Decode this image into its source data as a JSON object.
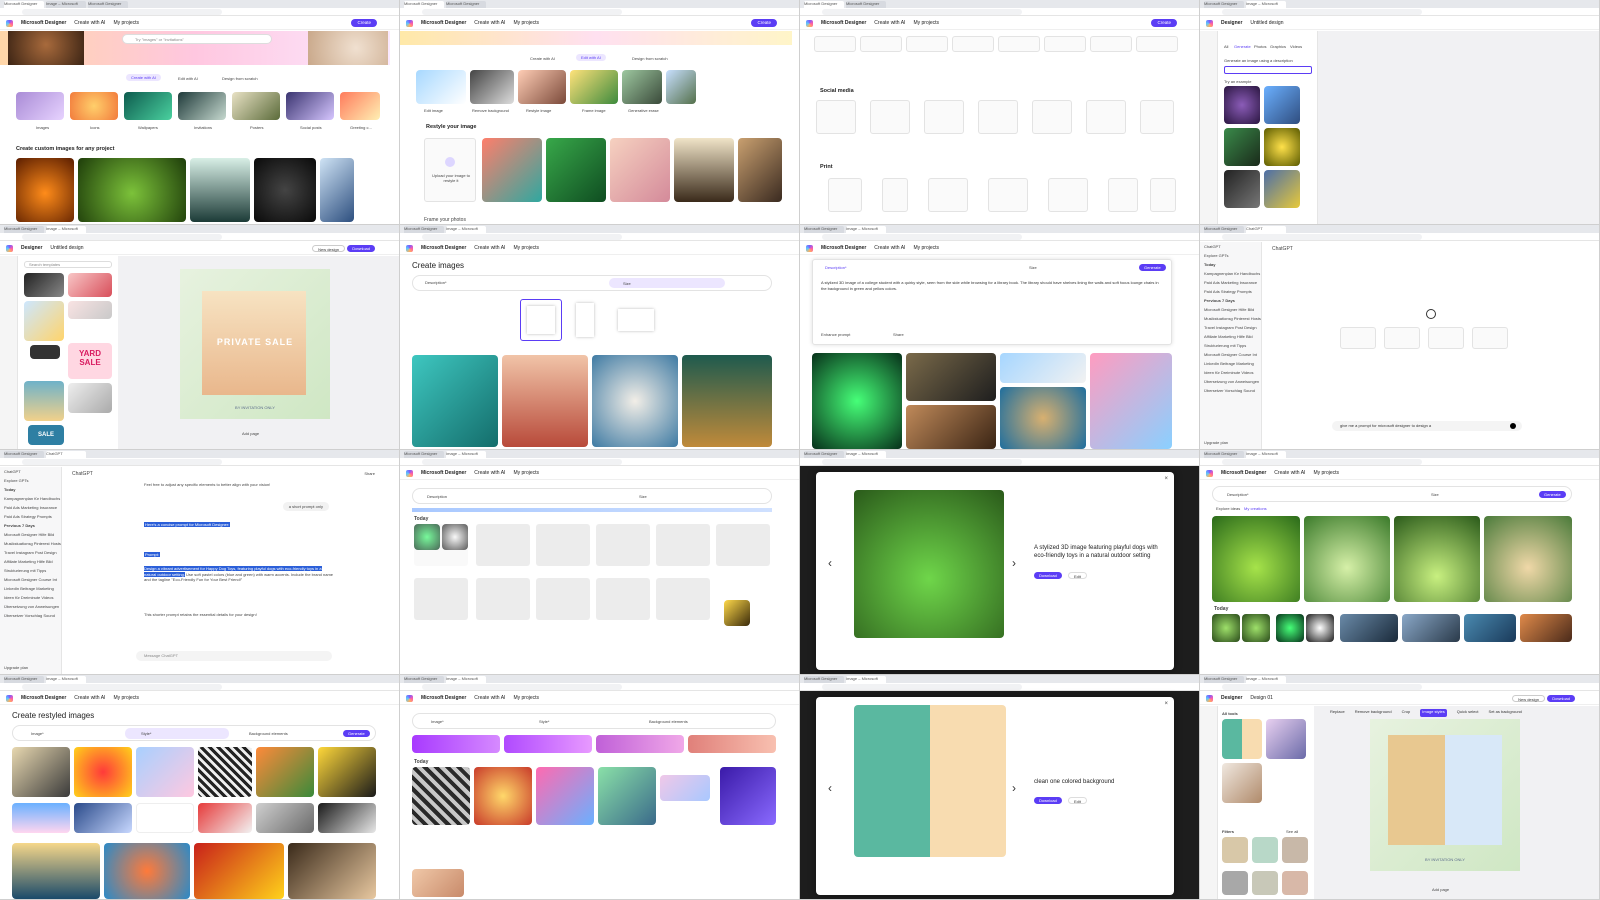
{
  "brand": "Microsoft Designer",
  "nav": {
    "create_with_ai": "Create with AI",
    "my_projects": "My projects",
    "create": "Create",
    "untitled": "Untitled design"
  },
  "tabs": [
    "Microsoft Designer",
    "Image – Microsoft",
    "Microsoft Designer",
    "ChatGPT"
  ],
  "p1": {
    "search_placeholder": "Try \"images\" or \"invitations\"",
    "options": [
      "Create with AI",
      "Edit with AI",
      "Design from scratch"
    ],
    "cats": [
      "Images",
      "Icons",
      "Wallpapers",
      "Invitations",
      "Posters",
      "Social posts",
      "Greeting c..."
    ],
    "section": "Create custom images for any project"
  },
  "p2": {
    "options": [
      "Create with AI",
      "Edit with AI",
      "Design from scratch"
    ],
    "tools": [
      "Edit image",
      "Remove background",
      "Restyle image",
      "Frame image",
      "Generative erase"
    ],
    "section": "Restyle your image",
    "upload": "Upload your image to restyle it",
    "next": "Frame your photos"
  },
  "p3": {
    "social": "Social media",
    "print": "Print"
  },
  "p4": {
    "designer": "Designer",
    "tabs": [
      "All",
      "Generate",
      "Photos",
      "Graphics",
      "Videos"
    ],
    "prompt_label": "Generate an image using a description",
    "try": "Try an example"
  },
  "p5": {
    "new_design": "New design",
    "download": "Download",
    "search": "Search templates",
    "yard": "YARD SALE",
    "sale": "SALE",
    "private": "PRIVATE SALE",
    "sub": "BY INVITATION ONLY",
    "addpage": "Add page"
  },
  "p6": {
    "title": "Create images",
    "desc": "Description*",
    "size": "Size"
  },
  "p7": {
    "desc": "Description*",
    "size": "Size",
    "prompt": "A stylized 3D image of a college student with a quirky style, seen from the side while browsing for a library book. The library should have shelves lining the walls and soft focus lounge chairs in the background in green and yellow colors.",
    "generate": "Generate",
    "enhance": "Enhance prompt",
    "share": "Share"
  },
  "p8": {
    "chatgpt": "ChatGPT",
    "input": "give me a prompt for microsoft designer to design a",
    "upgrade": "Upgrade plan",
    "items": [
      "ChatGPT",
      "Explore GPTs",
      "Today",
      "Kampagnenplan für Handbuchs",
      "Paid Ads Marketing Insurance",
      "Paid Ads Strategy Prompts",
      "Previous 7 Days",
      "Microsoft Designer Hilfe Bild",
      "Musikstuationsg Pinterest Hosts",
      "Travel Instagram Post Design",
      "Affiliate Marketing Hilfe Bild",
      "Strukturierung mit Tipps",
      "Microsoft Designer Course Int",
      "LinkedIn Beitrage Marketing",
      "Ideen für Dreiminute Videos",
      "Übersetzung von Anweisungen",
      "Übersetzer Vorschlag Sound"
    ]
  },
  "p9": {
    "chatgpt": "ChatGPT",
    "msg1": "Feel free to adjust any specific elements to better align with your vision!",
    "user": "a short prompt only",
    "hl1": "Here's a concise prompt for Microsoft Designer:",
    "hl2": "Prompt:",
    "hl3": "Design a vibrant advertisement for Happy Dog Toys, featuring playful dogs with eco-friendly toys in a natural outdoor setting.",
    "rest": "Use soft pastel colors (blue and green) with warm accents. Include the brand name and the tagline \"Eco-Friendly Fun for Your Best Friend!\"",
    "msg2": "This shorter prompt retains the essential details for your design!",
    "input": "Message ChatGPT",
    "share": "Share"
  },
  "p10": {
    "today": "Today",
    "desc": "Description",
    "size": "Size"
  },
  "p11": {
    "caption": "A stylized 3D image featuring playful dogs with eco-friendly toys in a natural outdoor setting",
    "download": "Download",
    "edit": "Edit"
  },
  "p12": {
    "desc": "Description*",
    "size": "Size",
    "generate": "Generate",
    "tabs": [
      "Explore ideas",
      "My creations"
    ],
    "today": "Today"
  },
  "p13": {
    "title": "Create restyled images",
    "image": "Image*",
    "style": "Style*",
    "bg": "Background elements",
    "generate": "Generate"
  },
  "p14": {
    "image": "Image*",
    "style": "Style*",
    "bg": "Background elements",
    "today": "Today"
  },
  "p15": {
    "caption": "clean one colored background",
    "download": "Download",
    "edit": "Edit"
  },
  "p16": {
    "designer": "Designer",
    "untitled": "Design 01",
    "new_design": "New design",
    "download": "Download",
    "tools": [
      "Replace",
      "Remove background",
      "Crop",
      "Image styles",
      "Quick select",
      "Set as background"
    ],
    "all_tools": "All tools",
    "filters": "Filters",
    "see_all": "See all",
    "sub": "BY INVITATION ONLY",
    "addpage": "Add page"
  }
}
